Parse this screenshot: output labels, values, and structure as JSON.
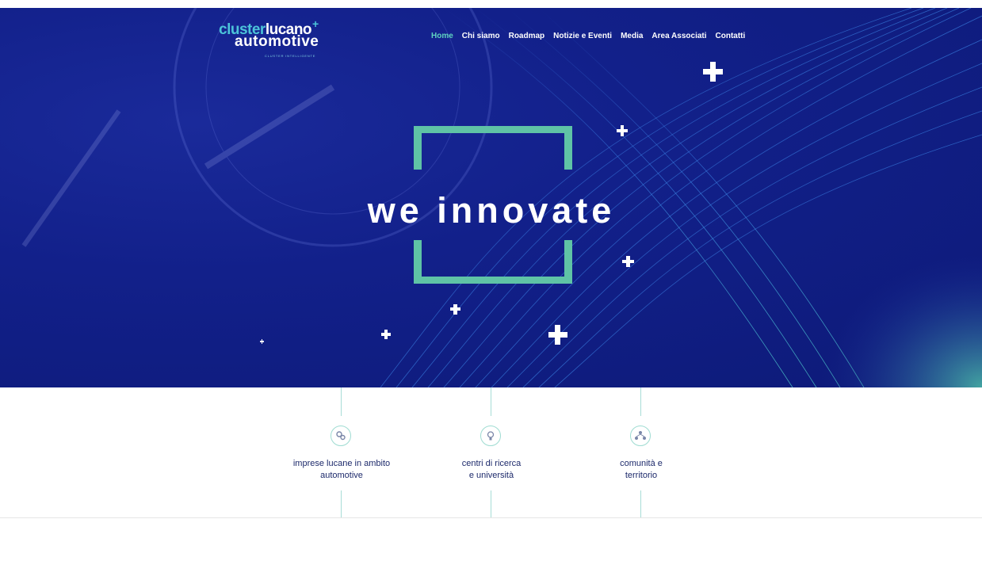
{
  "logo": {
    "line1_a": "cluster",
    "line1_b": "lucano",
    "line2": "automotive",
    "tagline": "CLUSTER INTELLIGENTE",
    "plus": "+"
  },
  "nav": {
    "items": [
      {
        "label": "Home",
        "active": true
      },
      {
        "label": "Chi siamo"
      },
      {
        "label": "Roadmap"
      },
      {
        "label": "Notizie e Eventi"
      },
      {
        "label": "Media"
      },
      {
        "label": "Area Associati"
      },
      {
        "label": "Contatti"
      }
    ]
  },
  "hero": {
    "headline": "we innovate",
    "accent_color": "#5fc3a6",
    "bg_color": "#12208a"
  },
  "features": [
    {
      "icon": "gears-icon",
      "label_line1": "imprese lucane in ambito",
      "label_line2": "automotive"
    },
    {
      "icon": "lightbulb-icon",
      "label_line1": "centri di ricerca",
      "label_line2": "e università"
    },
    {
      "icon": "community-icon",
      "label_line1": "comunità e",
      "label_line2": "territorio"
    }
  ]
}
